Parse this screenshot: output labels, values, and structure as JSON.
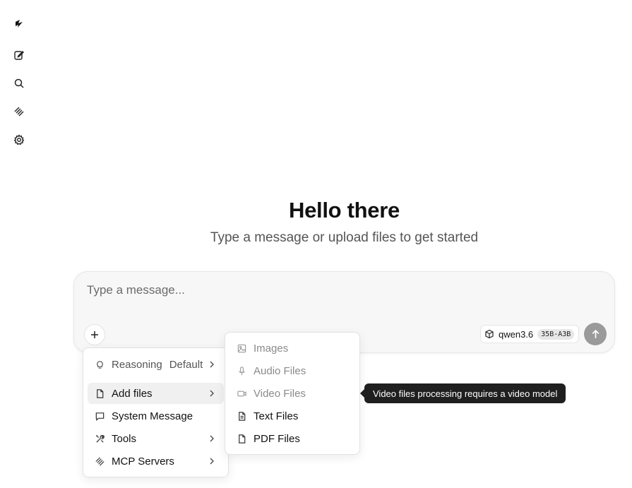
{
  "sidebar": {
    "items": [
      {
        "icon": "logo-icon"
      },
      {
        "icon": "new-chat-icon"
      },
      {
        "icon": "search-icon"
      },
      {
        "icon": "mcp-icon"
      },
      {
        "icon": "gear-icon"
      }
    ]
  },
  "hero": {
    "title": "Hello there",
    "subtitle": "Type a message or upload files to get started"
  },
  "composer": {
    "placeholder": "Type a message...",
    "model_name": "qwen3.6",
    "model_badge": "35B-A3B"
  },
  "attach_menu": {
    "items": [
      {
        "label": "Reasoning",
        "extra": "Default",
        "icon": "lightbulb-icon"
      },
      {
        "label": "Add files",
        "icon": "file-icon"
      },
      {
        "label": "System Message",
        "icon": "message-icon"
      },
      {
        "label": "Tools",
        "icon": "tools-icon"
      },
      {
        "label": "MCP Servers",
        "icon": "mcp-icon"
      }
    ]
  },
  "files_submenu": {
    "items": [
      {
        "label": "Images",
        "icon": "image-icon",
        "disabled": true
      },
      {
        "label": "Audio Files",
        "icon": "mic-icon",
        "disabled": true
      },
      {
        "label": "Video Files",
        "icon": "video-icon",
        "disabled": true
      },
      {
        "label": "Text Files",
        "icon": "text-file-icon",
        "disabled": false
      },
      {
        "label": "PDF Files",
        "icon": "pdf-file-icon",
        "disabled": false
      }
    ]
  },
  "tooltip": {
    "text": "Video files processing requires a video model"
  },
  "colors": {
    "send_button": "#9a9a9a",
    "tooltip_bg": "#1f1f1f",
    "menu_active": "#f0f0f0"
  }
}
